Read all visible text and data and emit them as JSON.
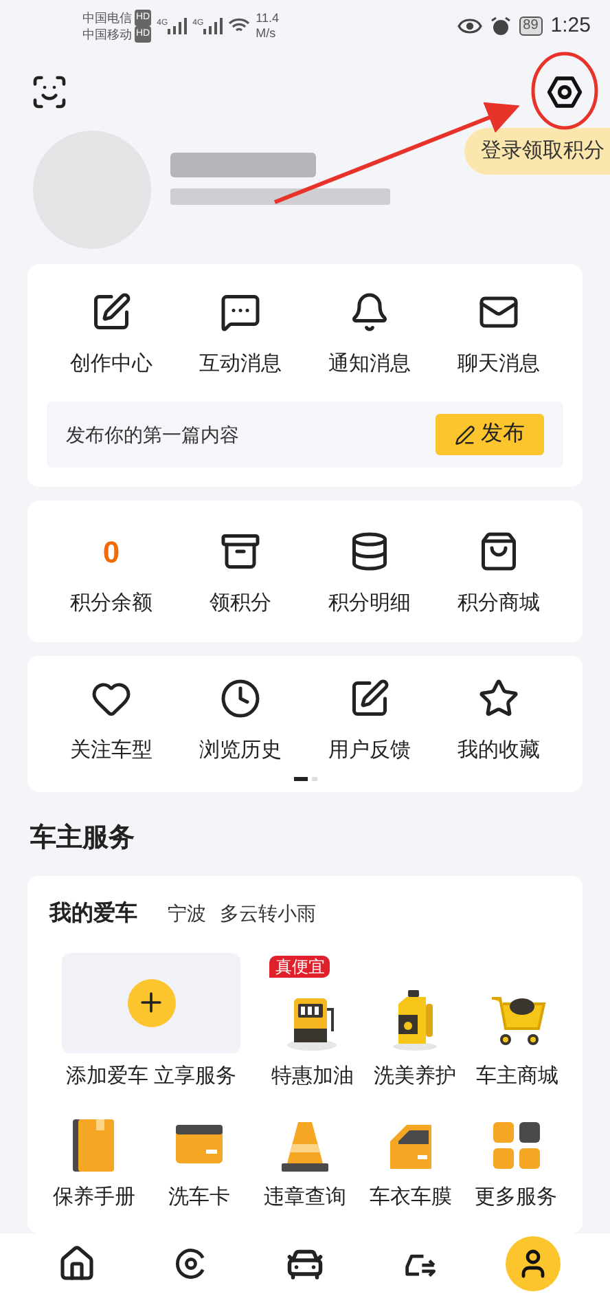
{
  "status_bar": {
    "carrier_1": "中国电信",
    "carrier_2": "中国移动",
    "hd_badges": [
      "HD",
      "HD"
    ],
    "network": [
      "4G",
      "4G"
    ],
    "speed": "11.4",
    "speed_unit": "M/s",
    "battery": "89",
    "time": "1:25"
  },
  "login_tooltip": "登录领取积分",
  "messages": {
    "items": [
      {
        "label": "创作中心"
      },
      {
        "label": "互动消息"
      },
      {
        "label": "通知消息"
      },
      {
        "label": "聊天消息"
      }
    ],
    "publish_prompt": "发布你的第一篇内容",
    "publish_button": "发布"
  },
  "points": {
    "items": [
      {
        "kind": "number",
        "value": "0",
        "label": "积分余额"
      },
      {
        "kind": "icon",
        "label": "领积分"
      },
      {
        "kind": "icon",
        "label": "积分明细"
      },
      {
        "kind": "icon",
        "label": "积分商城"
      }
    ]
  },
  "shortcuts": {
    "items": [
      {
        "label": "关注车型"
      },
      {
        "label": "浏览历史"
      },
      {
        "label": "用户反馈"
      },
      {
        "label": "我的收藏"
      }
    ],
    "pages": [
      {
        "selected": true
      },
      {
        "selected": false
      }
    ]
  },
  "section_title": "车主服务",
  "my_car": {
    "title": "我的爱车",
    "city": "宁波",
    "weather": "多云转小雨",
    "add_label": "添加爱车 立享服务",
    "services": [
      {
        "label": "特惠加油",
        "badge": "真便宜"
      },
      {
        "label": "洗美养护"
      },
      {
        "label": "车主商城"
      }
    ],
    "more": [
      {
        "label": "保养手册"
      },
      {
        "label": "洗车卡"
      },
      {
        "label": "违章查询"
      },
      {
        "label": "车衣车膜"
      },
      {
        "label": "更多服务"
      }
    ]
  },
  "bottom_nav": [
    {
      "selected": false
    },
    {
      "selected": false
    },
    {
      "selected": false
    },
    {
      "selected": false
    },
    {
      "selected": true
    }
  ]
}
